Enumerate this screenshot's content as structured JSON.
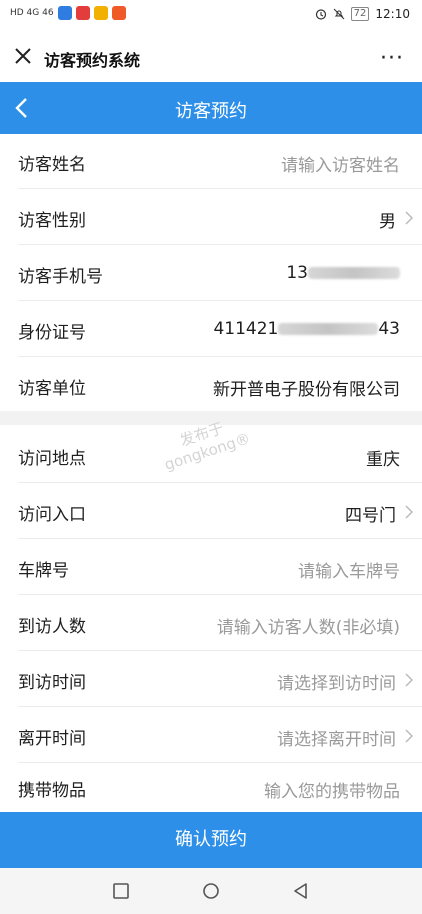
{
  "status_bar": {
    "network": "HD 4G 46",
    "battery": "72",
    "time": "12:10"
  },
  "top_bar": {
    "title": "访客预约系统",
    "more": "···"
  },
  "header": {
    "title": "访客预约"
  },
  "form": {
    "visitor_name": {
      "label": "访客姓名",
      "placeholder": "请输入访客姓名"
    },
    "visitor_gender": {
      "label": "访客性别",
      "value": "男"
    },
    "visitor_phone": {
      "label": "访客手机号",
      "value_prefix": "13",
      "value_suffix": ""
    },
    "id_number": {
      "label": "身份证号",
      "value_prefix": "411421",
      "value_suffix": "43"
    },
    "visitor_company": {
      "label": "访客单位",
      "value": "新开普电子股份有限公司"
    },
    "visit_location": {
      "label": "访问地点",
      "value": "重庆"
    },
    "visit_entrance": {
      "label": "访问入口",
      "value": "四号门"
    },
    "plate_number": {
      "label": "车牌号",
      "placeholder": "请输入车牌号"
    },
    "visitor_count": {
      "label": "到访人数",
      "placeholder": "请输入访客人数(非必填)"
    },
    "visit_time": {
      "label": "到访时间",
      "placeholder": "请选择到访时间"
    },
    "leave_time": {
      "label": "离开时间",
      "placeholder": "请选择离开时间"
    },
    "carried_items": {
      "label": "携带物品",
      "placeholder": "输入您的携带物品"
    }
  },
  "confirm_button": {
    "label": "确认预约"
  },
  "watermark": {
    "line1": "发布于",
    "line2": "gongkong®"
  },
  "colors": {
    "accent": "#2d8fe7",
    "placeholder": "#9a9a9a"
  },
  "icons": [
    "close-icon",
    "more-icon",
    "back-icon",
    "chevron-right-icon",
    "square-nav-icon",
    "circle-nav-icon",
    "triangle-back-nav-icon"
  ]
}
